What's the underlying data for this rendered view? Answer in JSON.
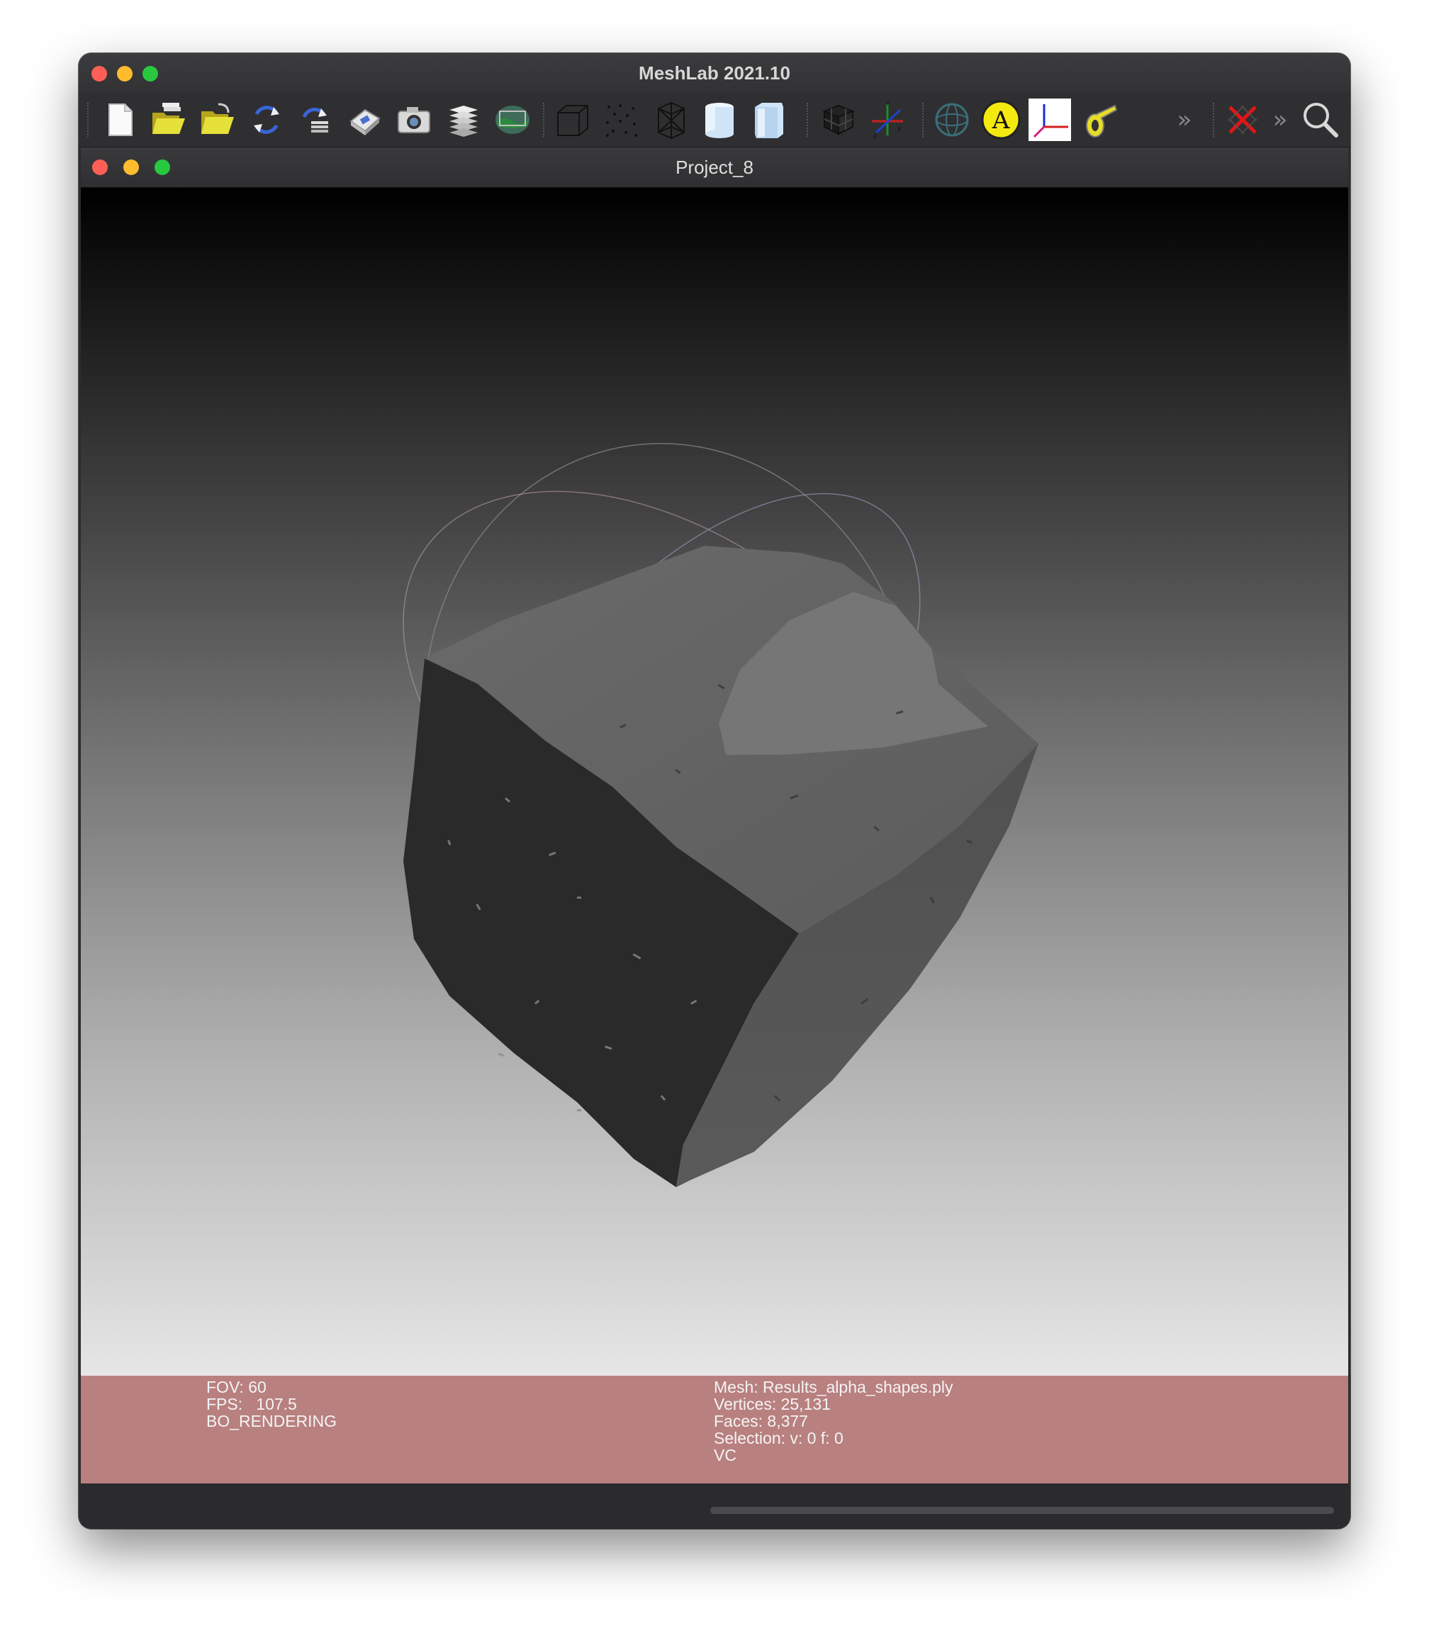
{
  "app": {
    "title": "MeshLab 2021.10"
  },
  "toolbar": {
    "buttons": [
      {
        "name": "new-project-icon"
      },
      {
        "name": "open-project-icon"
      },
      {
        "name": "import-mesh-icon"
      },
      {
        "name": "reload-icon"
      },
      {
        "name": "reload-all-icon"
      },
      {
        "name": "export-mesh-icon"
      },
      {
        "name": "snapshot-icon"
      },
      {
        "name": "layers-icon"
      },
      {
        "name": "raster-icon"
      },
      {
        "name": "bounding-box-icon"
      },
      {
        "name": "points-icon"
      },
      {
        "name": "wireframe-icon"
      },
      {
        "name": "flat-shading-icon"
      },
      {
        "name": "smooth-shading-icon"
      },
      {
        "name": "grid-icon"
      },
      {
        "name": "axis-icon"
      },
      {
        "name": "trackball-icon"
      },
      {
        "name": "annotation-icon"
      },
      {
        "name": "align-icon"
      },
      {
        "name": "measure-icon"
      },
      {
        "name": "more-icon"
      },
      {
        "name": "delete-icon"
      },
      {
        "name": "more-icon"
      },
      {
        "name": "search-icon"
      }
    ],
    "annotation_letter": "A",
    "overflow_label": "»"
  },
  "document": {
    "title": "Project_8"
  },
  "info": {
    "fov": "FOV: 60",
    "fps": "FPS:   107.5",
    "mode": "BO_RENDERING",
    "mesh": "Mesh: Results_alpha_shapes.ply",
    "vertices": "Vertices: 25,131",
    "faces": "Faces: 8,377",
    "selection": "Selection: v: 0 f: 0",
    "color": "VC"
  },
  "colors": {
    "info_panel": "#b98080",
    "window": "#2c2c2e"
  }
}
